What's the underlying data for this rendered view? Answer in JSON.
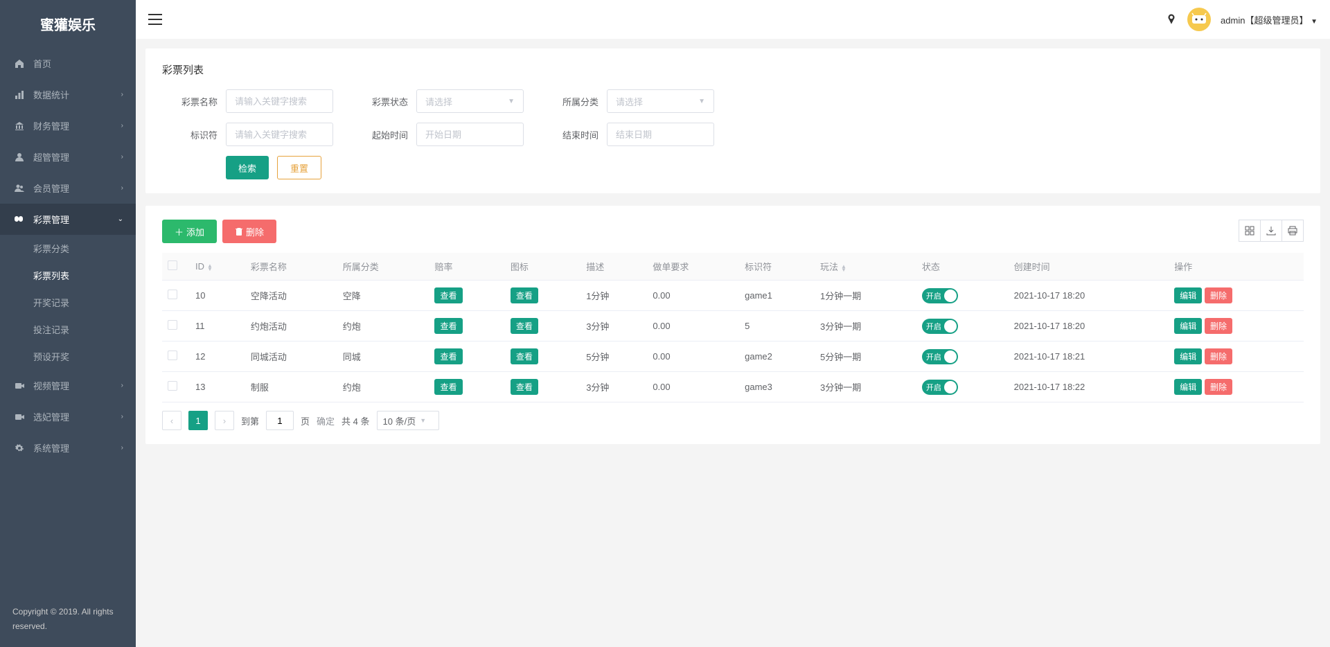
{
  "brand": "蜜獾娱乐",
  "copyright": "Copyright © 2019. All rights reserved.",
  "topbar": {
    "user_label": "admin【超级管理员】"
  },
  "sidebar": {
    "items": [
      {
        "label": "首页",
        "icon": "home",
        "expandable": false
      },
      {
        "label": "数据统计",
        "icon": "bars",
        "expandable": true
      },
      {
        "label": "财务管理",
        "icon": "bank",
        "expandable": true
      },
      {
        "label": "超管管理",
        "icon": "user",
        "expandable": true
      },
      {
        "label": "会员管理",
        "icon": "users",
        "expandable": true
      },
      {
        "label": "彩票管理",
        "icon": "mask",
        "expandable": true,
        "active": true,
        "children": [
          {
            "label": "彩票分类"
          },
          {
            "label": "彩票列表",
            "active": true
          },
          {
            "label": "开奖记录"
          },
          {
            "label": "投注记录"
          },
          {
            "label": "预设开奖"
          }
        ]
      },
      {
        "label": "视频管理",
        "icon": "video",
        "expandable": true
      },
      {
        "label": "选妃管理",
        "icon": "video",
        "expandable": true
      },
      {
        "label": "系统管理",
        "icon": "gear",
        "expandable": true
      }
    ]
  },
  "page": {
    "title": "彩票列表",
    "filters": {
      "name_label": "彩票名称",
      "name_ph": "请输入关键字搜索",
      "status_label": "彩票状态",
      "status_ph": "请选择",
      "category_label": "所属分类",
      "category_ph": "请选择",
      "identifier_label": "标识符",
      "identifier_ph": "请输入关键字搜索",
      "start_label": "起始时间",
      "start_ph": "开始日期",
      "end_label": "结束时间",
      "end_ph": "结束日期",
      "search_btn": "检索",
      "reset_btn": "重置"
    },
    "toolbar": {
      "add_btn": "添加",
      "delete_btn": "删除"
    },
    "columns": {
      "id": "ID",
      "name": "彩票名称",
      "category": "所属分类",
      "odds": "赔率",
      "icon": "图标",
      "desc": "描述",
      "req": "做单要求",
      "identifier": "标识符",
      "play": "玩法",
      "status": "状态",
      "created": "创建时间",
      "action": "操作"
    },
    "view_btn": "查看",
    "edit_btn": "编辑",
    "del_btn": "删除",
    "toggle_label": "开启",
    "rows": [
      {
        "id": "10",
        "name": "空降活动",
        "category": "空降",
        "desc": "1分钟",
        "req": "0.00",
        "identifier": "game1",
        "play": "1分钟一期",
        "created": "2021-10-17 18:20"
      },
      {
        "id": "11",
        "name": "约炮活动",
        "category": "约炮",
        "desc": "3分钟",
        "req": "0.00",
        "identifier": "5",
        "play": "3分钟一期",
        "created": "2021-10-17 18:20"
      },
      {
        "id": "12",
        "name": "同城活动",
        "category": "同城",
        "desc": "5分钟",
        "req": "0.00",
        "identifier": "game2",
        "play": "5分钟一期",
        "created": "2021-10-17 18:21"
      },
      {
        "id": "13",
        "name": "制服",
        "category": "约炮",
        "desc": "3分钟",
        "req": "0.00",
        "identifier": "game3",
        "play": "3分钟一期",
        "created": "2021-10-17 18:22"
      }
    ],
    "pagination": {
      "goto_label": "到第",
      "page_suffix": "页",
      "confirm": "确定",
      "total": "共 4 条",
      "per_page": "10 条/页",
      "current": "1",
      "goto_value": "1"
    }
  }
}
